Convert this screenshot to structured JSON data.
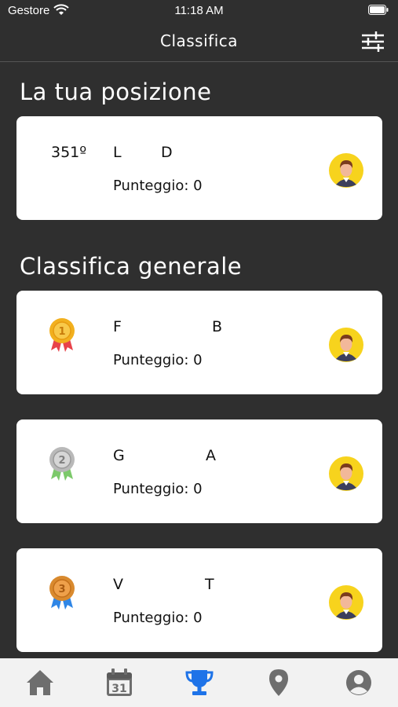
{
  "status_bar": {
    "carrier": "Gestore",
    "time": "11:18 AM"
  },
  "header": {
    "title": "Classifica"
  },
  "my_position": {
    "section_title": "La tua posizione",
    "rank": "351º",
    "first_name": "L",
    "last_name": "D",
    "score_label": "Punteggio: 0"
  },
  "leaderboard": {
    "section_title": "Classifica generale",
    "entries": [
      {
        "medal_number": "1",
        "first_name": "F",
        "last_name": "B",
        "score_label": "Punteggio: 0"
      },
      {
        "medal_number": "2",
        "first_name": "G",
        "last_name": "A",
        "score_label": "Punteggio: 0"
      },
      {
        "medal_number": "3",
        "first_name": "V",
        "last_name": "T",
        "score_label": "Punteggio: 0"
      }
    ]
  },
  "tab_bar": {
    "active_tab": "leaderboard",
    "calendar_day": "31",
    "tabs": [
      "home-icon",
      "calendar-icon",
      "trophy-icon",
      "map-pin-icon",
      "user-icon"
    ]
  },
  "colors": {
    "background": "#2f2f2f",
    "accent": "#1e73e8",
    "tab_inactive": "#6e6e6e",
    "gold": "#f2b01e",
    "silver": "#b9b9b9",
    "bronze": "#d98a2e"
  }
}
